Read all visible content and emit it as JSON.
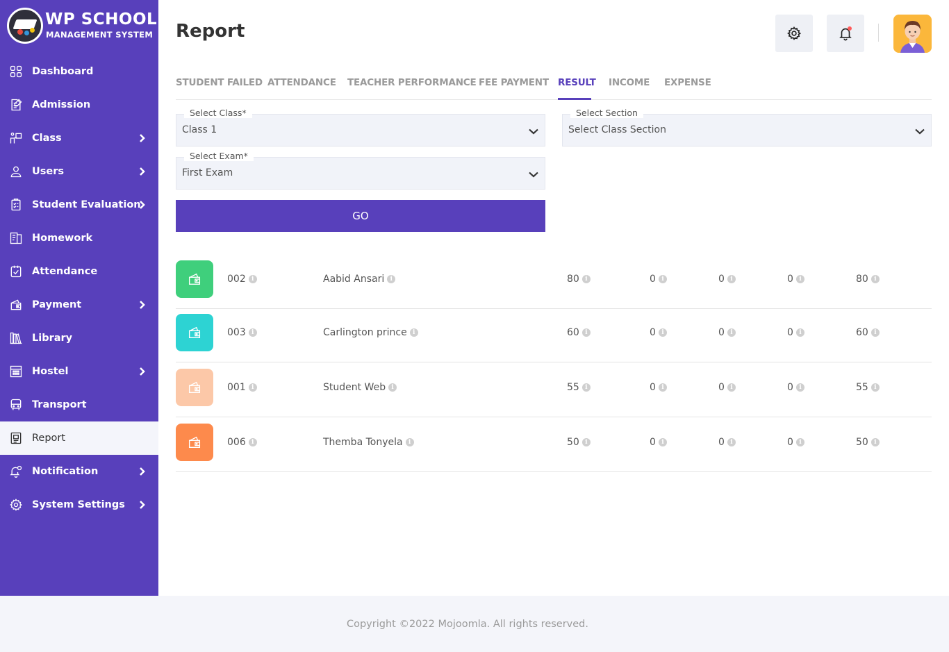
{
  "brand": {
    "title": "WP SCHOOL",
    "subtitle": "MANAGEMENT SYSTEM"
  },
  "sidebar": {
    "items": [
      {
        "label": "Dashboard",
        "icon": "dashboard-icon",
        "has_children": false,
        "active": false
      },
      {
        "label": "Admission",
        "icon": "admission-icon",
        "has_children": false,
        "active": false
      },
      {
        "label": "Class",
        "icon": "class-icon",
        "has_children": true,
        "active": false
      },
      {
        "label": "Users",
        "icon": "user-icon",
        "has_children": true,
        "active": false
      },
      {
        "label": "Student Evaluation",
        "icon": "evaluation-icon",
        "has_children": true,
        "active": false
      },
      {
        "label": "Homework",
        "icon": "homework-icon",
        "has_children": false,
        "active": false
      },
      {
        "label": "Attendance",
        "icon": "attendance-icon",
        "has_children": false,
        "active": false
      },
      {
        "label": "Payment",
        "icon": "wallet-icon",
        "has_children": true,
        "active": false
      },
      {
        "label": "Library",
        "icon": "library-icon",
        "has_children": false,
        "active": false
      },
      {
        "label": "Hostel",
        "icon": "hostel-icon",
        "has_children": true,
        "active": false
      },
      {
        "label": "Transport",
        "icon": "bus-icon",
        "has_children": false,
        "active": false
      },
      {
        "label": "Report",
        "icon": "report-icon",
        "has_children": false,
        "active": true
      },
      {
        "label": "Notification",
        "icon": "notification-icon",
        "has_children": true,
        "active": false
      },
      {
        "label": "System Settings",
        "icon": "settings-icon",
        "has_children": true,
        "active": false
      }
    ]
  },
  "header": {
    "title": "Report",
    "settings_icon": "gear-icon",
    "notification_icon": "bell-icon",
    "avatar": "user-avatar"
  },
  "tabs": [
    {
      "label": "STUDENT FAILED",
      "active": false
    },
    {
      "label": "ATTENDANCE",
      "active": false
    },
    {
      "label": "TEACHER PERFORMANCE",
      "active": false
    },
    {
      "label": "FEE PAYMENT",
      "active": false
    },
    {
      "label": "RESULT",
      "active": true
    },
    {
      "label": "INCOME",
      "active": false
    },
    {
      "label": "EXPENSE",
      "active": false
    }
  ],
  "form": {
    "class_label": "Select Class*",
    "class_value": "Class 1",
    "section_label": "Select Section",
    "section_value": "Select Class Section",
    "exam_label": "Select Exam*",
    "exam_value": "First Exam",
    "go_label": "GO"
  },
  "results": [
    {
      "color": "#3fcf7c",
      "roll": "002",
      "name": "Aabid Ansari",
      "scores": [
        "80",
        "0",
        "0",
        "0",
        "80"
      ]
    },
    {
      "color": "#2dd3d3",
      "roll": "003",
      "name": "Carlington prince",
      "scores": [
        "60",
        "0",
        "0",
        "0",
        "60"
      ]
    },
    {
      "color": "#fcc8a8",
      "roll": "001",
      "name": "Student Web",
      "scores": [
        "55",
        "0",
        "0",
        "0",
        "55"
      ]
    },
    {
      "color": "#fd8a4c",
      "roll": "006",
      "name": "Themba Tonyela",
      "scores": [
        "50",
        "0",
        "0",
        "0",
        "50"
      ]
    }
  ],
  "footer": {
    "copyright": "Copyright ©2022 Mojoomla. All rights reserved."
  },
  "colors": {
    "primary": "#5840bb",
    "active_tab": "#5840bb",
    "footer_bg": "#f4f5fa"
  }
}
